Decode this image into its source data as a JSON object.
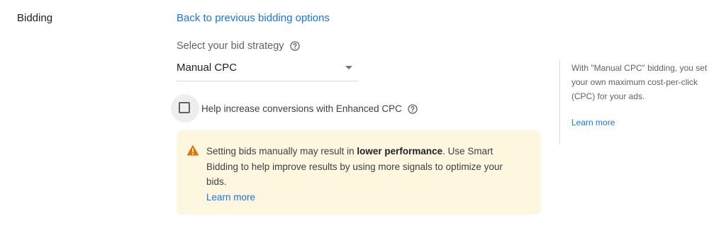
{
  "section": {
    "label": "Bidding"
  },
  "back_link": "Back to previous bidding options",
  "strategy": {
    "label": "Select your bid strategy",
    "selected": "Manual CPC"
  },
  "enhanced_cpc": {
    "label": "Help increase conversions with Enhanced CPC",
    "checked": false
  },
  "warning": {
    "pre": "Setting bids manually may result in ",
    "bold": "lower performance",
    "post": ". Use Smart Bidding to help improve results by using more signals to optimize your bids.",
    "link": "Learn more",
    "icon": "warning-triangle-icon",
    "background": "#fef7e0",
    "icon_color": "#e37400"
  },
  "side_panel": {
    "text": "With \"Manual CPC\" bidding, you set your own maximum cost-per-click (CPC) for your ads.",
    "link": "Learn more"
  },
  "colors": {
    "link": "#1a73e8",
    "text": "#3c4043"
  }
}
